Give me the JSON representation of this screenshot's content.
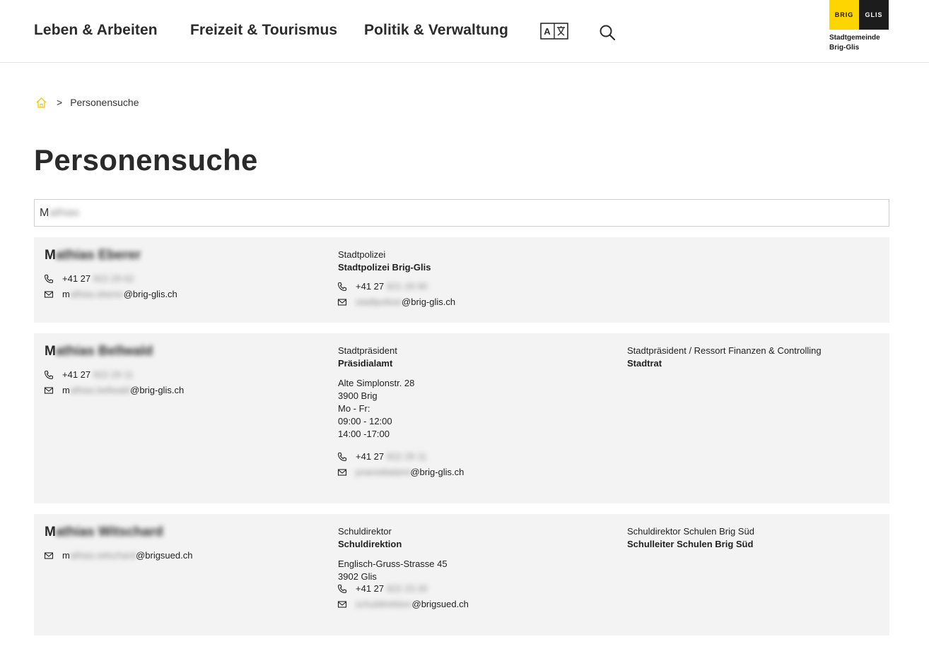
{
  "header": {
    "nav": [
      "Leben & Arbeiten",
      "Freizeit & Tourismus",
      "Politik & Verwaltung"
    ],
    "logo": {
      "left_text": "BRIG",
      "right_text": "GLIS",
      "line1": "Stadtgemeinde",
      "line2": "Brig-Glis"
    },
    "colors": {
      "brand_yellow": "#ffd500",
      "brand_black": "#1c1c1c"
    }
  },
  "breadcrumb": {
    "separator": ">",
    "current": "Personensuche"
  },
  "page_title": "Personensuche",
  "search": {
    "value_visible": "M",
    "value_blurred": "athias"
  },
  "results": [
    {
      "name_visible": "M",
      "name_blurred": "athias Eberer",
      "phone_prefix": "+41 27",
      "phone_blurred": "922 29 62",
      "email_visible_start": "m",
      "email_blurred": "athias.eberer",
      "email_domain": "@brig-glis.ch",
      "role": "Stadtpolizei",
      "unit": "Stadtpolizei Brig-Glis",
      "unit_phone_prefix": "+41 27",
      "unit_phone_blurred": "921 29 90",
      "unit_email_blurred": "stadtpolizei",
      "unit_email_domain": "@brig-glis.ch"
    },
    {
      "name_visible": "M",
      "name_blurred": "athias Bellwald",
      "phone_prefix": "+41 27",
      "phone_blurred": "922 29 11",
      "email_visible_start": "m",
      "email_blurred": "athias.bellwald",
      "email_domain": "@brig-glis.ch",
      "role": "Stadtpräsident",
      "unit": "Präsidialamt",
      "address": [
        "Alte Simplonstr. 28",
        "3900 Brig",
        "Mo - Fr:",
        "09:00 - 12:00",
        "14:00 -17:00"
      ],
      "unit_phone_prefix": "+41 27",
      "unit_phone_blurred": "922 29 11",
      "unit_email_blurred": "praesidialamt",
      "unit_email_domain": "@brig-glis.ch",
      "role2": "Stadtpräsident / Ressort Finanzen & Controlling",
      "unit2": "Stadtrat"
    },
    {
      "name_visible": "M",
      "name_blurred": "athias Witschard",
      "email_visible_start": "m",
      "email_blurred": "athias.witschard",
      "email_domain": "@brigsued.ch",
      "role": "Schuldirektor",
      "unit": "Schuldirektion",
      "address": [
        "Englisch-Gruss-Strasse 45",
        "3902 Glis"
      ],
      "unit_phone_prefix": "+41 27",
      "unit_phone_blurred": "922 23 30",
      "unit_email_blurred": "schuldirektion",
      "unit_email_domain": "@brigsued.ch",
      "role2": "Schuldirektor Schulen Brig Süd",
      "unit2": "Schulleiter Schulen Brig Süd"
    }
  ]
}
